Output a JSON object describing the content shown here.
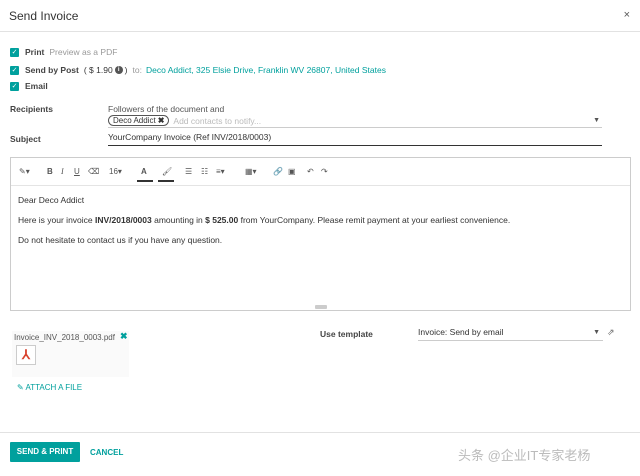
{
  "dialog": {
    "title": "Send Invoice",
    "close_glyph": "×"
  },
  "options": {
    "print": {
      "label": "Print",
      "hint": "Preview as a PDF"
    },
    "post": {
      "label": "Send by Post",
      "price": "( $ 1.90",
      "price_end": ")",
      "to": "to:",
      "address": "Deco Addict, 325 Elsie Drive, Franklin WV 26807, United States"
    },
    "email": {
      "label": "Email"
    }
  },
  "recipients": {
    "label": "Recipients",
    "text": "Followers of the document and",
    "tag": "Deco Addict",
    "placeholder": "Add contacts to notify..."
  },
  "subject": {
    "label": "Subject",
    "value": "YourCompany Invoice (Ref INV/2018/0003)"
  },
  "toolbar": {
    "font_size": "16",
    "color_letter": "A"
  },
  "body": {
    "greeting": "Dear Deco Addict",
    "line1_pre": "Here is your invoice ",
    "line1_ref": "INV/2018/0003",
    "line1_mid": " amounting in ",
    "line1_amount": "$ 525.00",
    "line1_post": " from YourCompany. Please remit payment at your earliest convenience.",
    "line2": "Do not hesitate to contact us if you have any question."
  },
  "attachment": {
    "filename": "Invoice_INV_2018_0003.pdf",
    "attach_label": "ATTACH A FILE"
  },
  "template": {
    "label": "Use template",
    "value": "Invoice: Send by email"
  },
  "footer": {
    "send_label": "SEND & PRINT",
    "cancel_label": "CANCEL"
  },
  "watermark": "头条 @企业IT专家老杨",
  "colors": {
    "accent": "#00a09d"
  }
}
